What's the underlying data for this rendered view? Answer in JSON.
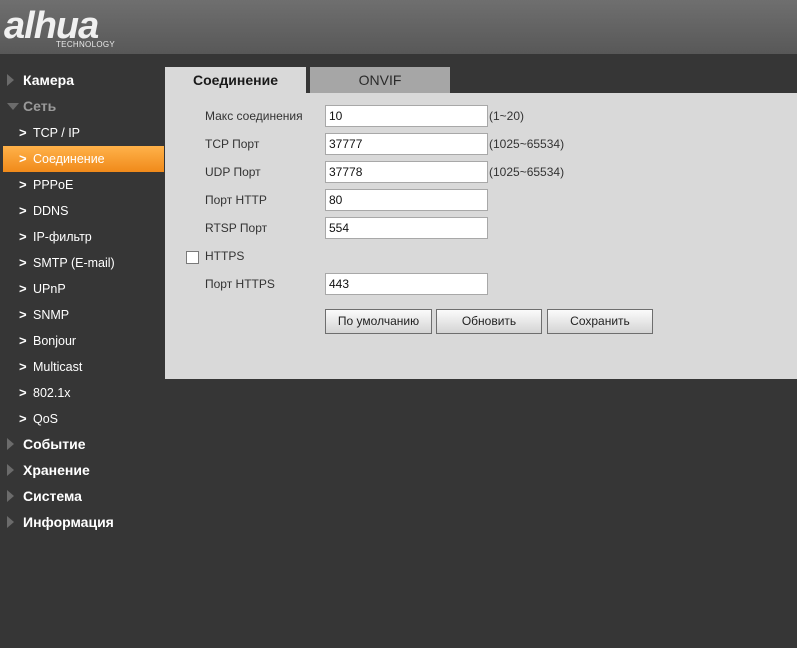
{
  "brand": {
    "name": "alhua",
    "tagline": "TECHNOLOGY"
  },
  "sidebar": {
    "sections_top": [
      {
        "label": "Камера"
      }
    ],
    "open_section": {
      "label": "Сеть"
    },
    "items": [
      {
        "label": "TCP / IP"
      },
      {
        "label": "Соединение"
      },
      {
        "label": "PPPoE"
      },
      {
        "label": "DDNS"
      },
      {
        "label": "IP-фильтр"
      },
      {
        "label": "SMTP (E-mail)"
      },
      {
        "label": "UPnP"
      },
      {
        "label": "SNMP"
      },
      {
        "label": "Bonjour"
      },
      {
        "label": "Multicast"
      },
      {
        "label": "802.1x"
      },
      {
        "label": "QoS"
      }
    ],
    "active_item": "Соединение",
    "sections_bottom": [
      {
        "label": "Событие"
      },
      {
        "label": "Хранение"
      },
      {
        "label": "Система"
      },
      {
        "label": "Информация"
      }
    ]
  },
  "tabs": [
    {
      "label": "Соединение",
      "active": true
    },
    {
      "label": "ONVIF",
      "active": false
    }
  ],
  "form": {
    "max_connections": {
      "label": "Макс соединения",
      "value": "10",
      "hint": "(1~20)"
    },
    "tcp_port": {
      "label": "TCP Порт",
      "value": "37777",
      "hint": "(1025~65534)"
    },
    "udp_port": {
      "label": "UDP Порт",
      "value": "37778",
      "hint": "(1025~65534)"
    },
    "http_port": {
      "label": "Порт HTTP",
      "value": "80"
    },
    "rtsp_port": {
      "label": "RTSP Порт",
      "value": "554"
    },
    "https": {
      "label": "HTTPS",
      "checked": false
    },
    "https_port": {
      "label": "Порт HTTPS",
      "value": "443"
    }
  },
  "buttons": {
    "default": "По умолчанию",
    "refresh": "Обновить",
    "save": "Сохранить"
  },
  "colors": {
    "active_item": "#f5a030",
    "background": "#363636",
    "panel": "#d9d9d9"
  }
}
